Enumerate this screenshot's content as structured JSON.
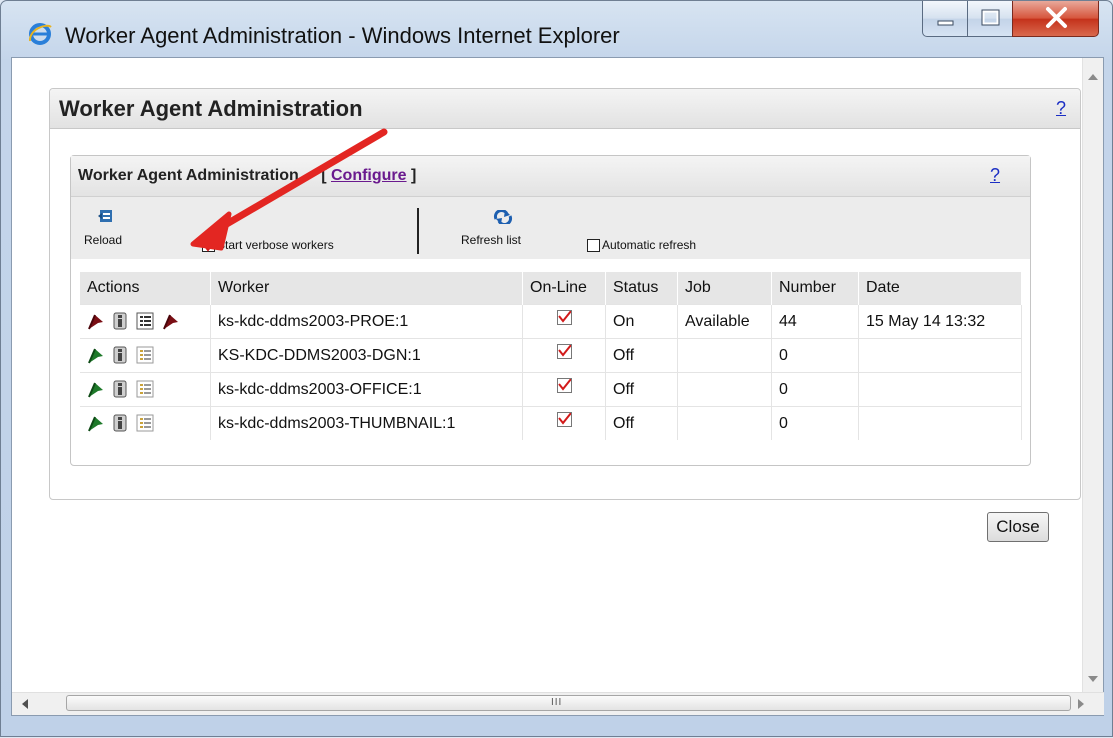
{
  "window": {
    "title": "Worker Agent Administration - Windows Internet Explorer"
  },
  "page": {
    "outer_title": "Worker Agent Administration",
    "help": "?",
    "close_label": "Close"
  },
  "panel": {
    "title": "Worker Agent Administration",
    "bracket_open": "[",
    "configure_label": "Configure",
    "bracket_close": "]",
    "help": "?"
  },
  "toolbar": {
    "reload_label": "Reload",
    "verbose_label": "Start verbose workers",
    "verbose_checked": true,
    "refresh_label": "Refresh list",
    "auto_refresh_label": "Automatic refresh",
    "auto_refresh_checked": false
  },
  "table": {
    "headers": [
      "Actions",
      "Worker",
      "On-Line",
      "Status",
      "Job",
      "Number",
      "Date"
    ],
    "rows": [
      {
        "flag_color": "red",
        "extra_flag": true,
        "worker": "ks-kdc-ddms2003-PROE:1",
        "online": true,
        "status": "On",
        "job": "Available",
        "number": "44",
        "date": "15 May 14 13:32"
      },
      {
        "flag_color": "green",
        "extra_flag": false,
        "worker": "KS-KDC-DDMS2003-DGN:1",
        "online": true,
        "status": "Off",
        "job": "",
        "number": "0",
        "date": ""
      },
      {
        "flag_color": "green",
        "extra_flag": false,
        "worker": "ks-kdc-ddms2003-OFFICE:1",
        "online": true,
        "status": "Off",
        "job": "",
        "number": "0",
        "date": ""
      },
      {
        "flag_color": "green",
        "extra_flag": false,
        "worker": "ks-kdc-ddms2003-THUMBNAIL:1",
        "online": true,
        "status": "Off",
        "job": "",
        "number": "0",
        "date": ""
      }
    ]
  },
  "scrollbar": {
    "grip": "III"
  },
  "colors": {
    "flag_red": "#7a0e14",
    "flag_green": "#1e7a2a",
    "check_red": "#d21a1a",
    "annotation_arrow": "#e32622",
    "link_blue": "#1b2ec4",
    "link_purple": "#6a1a8e"
  }
}
